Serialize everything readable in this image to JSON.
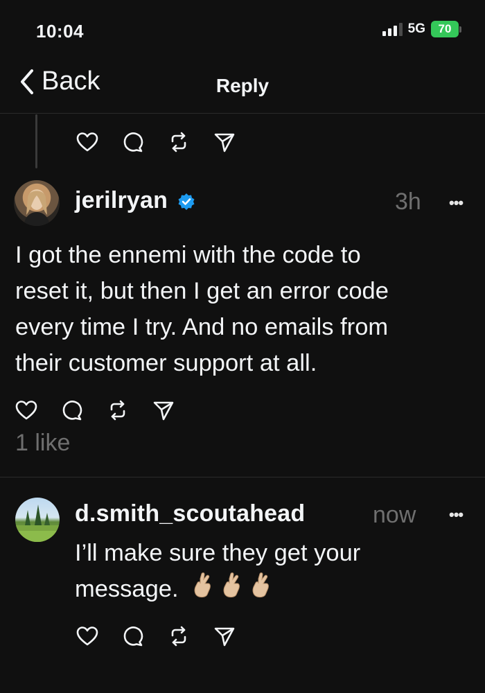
{
  "status_bar": {
    "time": "10:04",
    "network": "5G",
    "battery": "70"
  },
  "header": {
    "back_label": "Back",
    "title": "Reply"
  },
  "posts": [
    {
      "username": "jerilryan",
      "verified": true,
      "time": "3h",
      "text_lines": [
        "I got the ennemi with the code to",
        "reset it, but then I get an error code",
        "every time I try. And no emails from",
        "their customer support at all."
      ],
      "likes": "1 like"
    },
    {
      "username": "d.smith_scoutahead",
      "time": "now",
      "text_lines": [
        "I’ll make sure they get your",
        "message."
      ]
    }
  ],
  "icons": [
    "chevron-left-icon",
    "heart-icon",
    "comment-icon",
    "repost-icon",
    "share-icon",
    "more-icon",
    "verified-badge-icon"
  ],
  "colors": {
    "background": "#101010",
    "text": "#f3f5f7",
    "muted": "#6f6f6f",
    "verified": "#1d9bf0",
    "battery": "#34c759"
  }
}
